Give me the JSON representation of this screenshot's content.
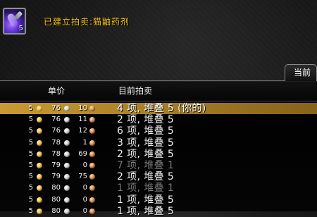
{
  "item": {
    "stack_count": "5"
  },
  "status": {
    "message": "已建立拍卖:猫鼬药剂"
  },
  "tab": {
    "label": "当前"
  },
  "table": {
    "headers": {
      "unit_price": "单价",
      "current_bid": "目前拍卖"
    },
    "rows": [
      {
        "gold": "5",
        "silver": "76",
        "copper": "10",
        "bid": "4 项, 堆叠 5 (你的)",
        "selected": true,
        "dim": false
      },
      {
        "gold": "5",
        "silver": "76",
        "copper": "11",
        "bid": "2 项, 堆叠 5",
        "selected": false,
        "dim": false
      },
      {
        "gold": "5",
        "silver": "76",
        "copper": "12",
        "bid": "6 项, 堆叠 5",
        "selected": false,
        "dim": false
      },
      {
        "gold": "5",
        "silver": "78",
        "copper": "1",
        "bid": "3 项, 堆叠 5",
        "selected": false,
        "dim": false
      },
      {
        "gold": "5",
        "silver": "78",
        "copper": "69",
        "bid": "2 项, 堆叠 5",
        "selected": false,
        "dim": false
      },
      {
        "gold": "5",
        "silver": "79",
        "copper": "0",
        "bid": "7 项, 堆叠 1",
        "selected": false,
        "dim": true
      },
      {
        "gold": "5",
        "silver": "79",
        "copper": "75",
        "bid": "2 项, 堆叠 5",
        "selected": false,
        "dim": false
      },
      {
        "gold": "5",
        "silver": "80",
        "copper": "0",
        "bid": "1 项, 堆叠 1",
        "selected": false,
        "dim": true
      },
      {
        "gold": "5",
        "silver": "80",
        "copper": "0",
        "bid": "1 项, 堆叠 5",
        "selected": false,
        "dim": false
      },
      {
        "gold": "5",
        "silver": "80",
        "copper": "0",
        "bid": "1 项, 堆叠 5",
        "selected": false,
        "dim": false
      }
    ]
  },
  "colors": {
    "status_text": "#f2c318",
    "selected_row": "#c99a33",
    "dim_text": "#787878"
  },
  "icons": {
    "item": "purple-potion-icon",
    "gold": "gold-coin-icon",
    "silver": "silver-coin-icon",
    "copper": "copper-coin-icon"
  }
}
